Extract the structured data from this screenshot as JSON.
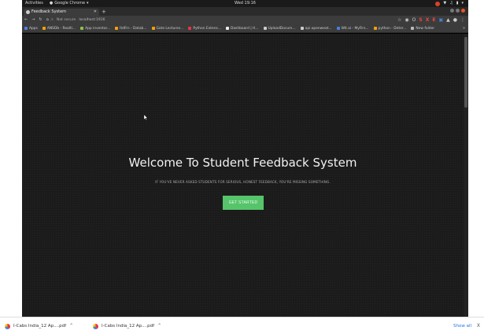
{
  "os_bar": {
    "activities": "Activities",
    "app_name": "Google Chrome",
    "clock": "Wed 19:16"
  },
  "browser": {
    "tab_title": "Feedback System",
    "address_warning": "Not secure",
    "address_url": "localhost:1916",
    "bookmarks": [
      {
        "label": "Apps",
        "color": "#4a7fe0"
      },
      {
        "label": "ANSDb - Realti...",
        "color": "#f4a300"
      },
      {
        "label": "App inventor...",
        "color": "#8bc34a"
      },
      {
        "label": "ItdFrn - Datab...",
        "color": "#f4a300"
      },
      {
        "label": "Gate Lectures...",
        "color": "#f4a300"
      },
      {
        "label": "Python Extens...",
        "color": "#e34"
      },
      {
        "label": "Dashboard | H...",
        "color": "#eee"
      },
      {
        "label": "UploadDocum...",
        "color": "#ccc"
      },
      {
        "label": "api.openweat...",
        "color": "#ccc"
      },
      {
        "label": "Wit.ai - MyFirs...",
        "color": "#4a7fe0"
      },
      {
        "label": "python - Deter...",
        "color": "#f4a300"
      },
      {
        "label": "New folder",
        "color": "#bbb"
      }
    ],
    "extensions": [
      "☆",
      "◉",
      "O",
      "S",
      "X",
      "E",
      "▣",
      "▲"
    ]
  },
  "page": {
    "title": "Welcome To Student Feedback System",
    "subtitle": "IF YOU'VE NEVER ASKED STUDENTS FOR SERIOUS, HONEST FEEDBACK, YOU'RE MISSING SOMETHING.",
    "cta_label": "GET STARTED",
    "cta_color": "#56c46a"
  },
  "downloads": {
    "items": [
      {
        "label": "I-Cabs India_12 Ap....pdf"
      },
      {
        "label": "I-Cabs India_12 Ap....pdf"
      }
    ],
    "show_all": "Show all",
    "close": "X"
  }
}
